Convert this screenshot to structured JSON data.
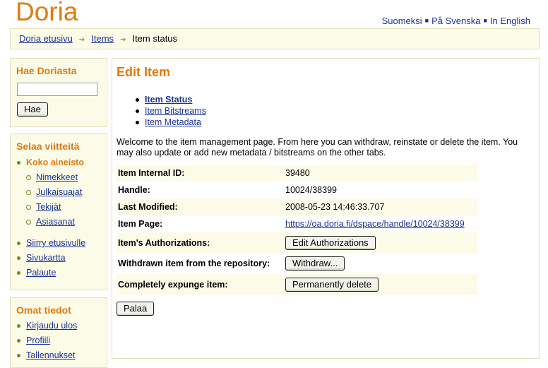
{
  "header": {
    "logo": "Doria",
    "languages": [
      "Suomeksi",
      "På Svenska",
      "In English"
    ]
  },
  "breadcrumb": {
    "items": [
      "Doria etusivu",
      "Items"
    ],
    "current": "Item status"
  },
  "search": {
    "title": "Hae Doriasta",
    "input_value": "",
    "button": "Hae"
  },
  "browse": {
    "title": "Selaa viitteitä",
    "all": "Koko aineisto",
    "sub_items": [
      "Nimekkeet",
      "Julkaisuajat",
      "Tekijät",
      "Asiasanat"
    ],
    "links": [
      "Siirry etusivulle",
      "Sivukartta",
      "Palaute"
    ]
  },
  "account": {
    "title": "Omat tiedot",
    "links": [
      "Kirjaudu ulos",
      "Profiili",
      "Tallennukset"
    ]
  },
  "main": {
    "title": "Edit Item",
    "tabs": [
      "Item Status",
      "Item Bitstreams",
      "Item Metadata"
    ],
    "intro": "Welcome to the item management page. From here you can withdraw, reinstate or delete the item. You may also update or add new metadata / bitstreams on the other tabs.",
    "rows": [
      {
        "label": "Item Internal ID:",
        "value": "39480"
      },
      {
        "label": "Handle:",
        "value": "10024/38399"
      },
      {
        "label": "Last Modified:",
        "value": "2008-05-23 14:46:33.707"
      },
      {
        "label": "Item Page:",
        "value": "https://oa.doria.fi/dspace/handle/10024/38399"
      },
      {
        "label": "Item's Authorizations:",
        "value": "Edit Authorizations"
      },
      {
        "label": "Withdrawn item from the repository:",
        "value": "Withdraw..."
      },
      {
        "label": "Completely expunge item:",
        "value": "Permanently delete"
      }
    ],
    "back_button": "Palaa"
  },
  "colors": {
    "accent": "#e07a10",
    "link": "#1a3399",
    "panel_bg": "#fbfbe8",
    "panel_border": "#e3e0b8",
    "bullet": "#6b8e23"
  }
}
